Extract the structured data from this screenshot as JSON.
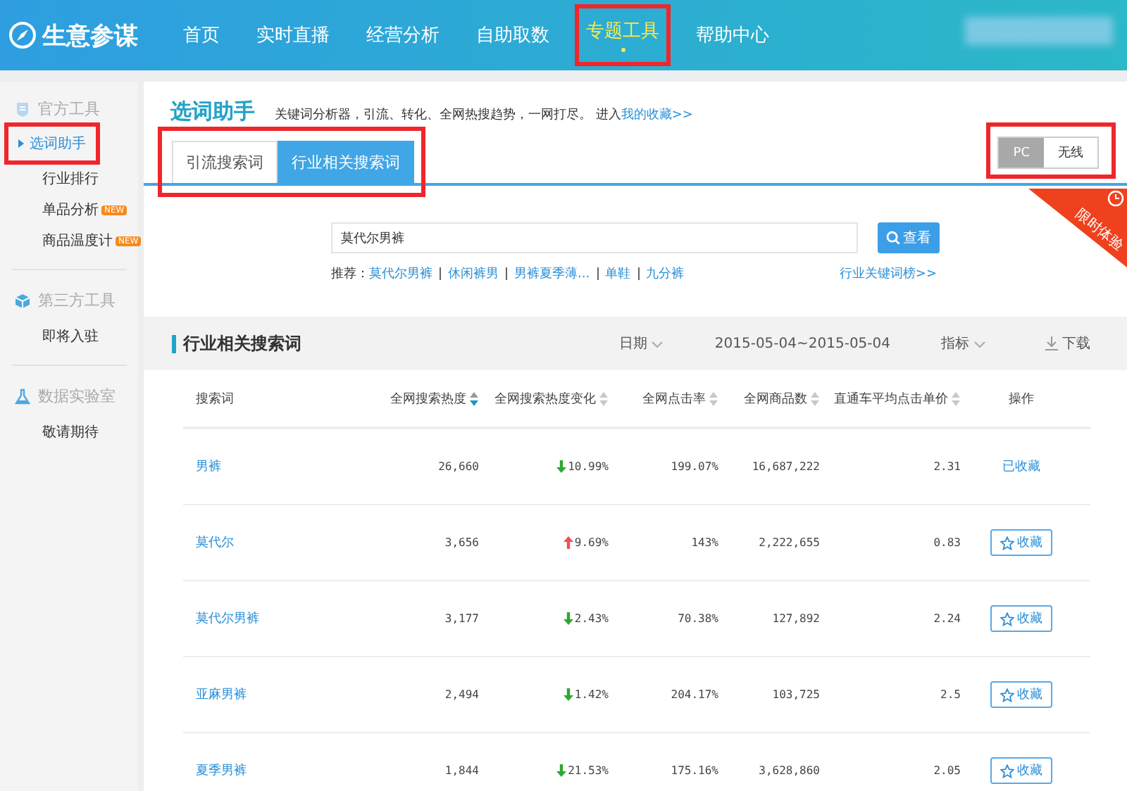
{
  "header": {
    "logo": "生意参谋",
    "nav": [
      {
        "label": "首页",
        "selected": false
      },
      {
        "label": "实时直播",
        "selected": false
      },
      {
        "label": "经营分析",
        "selected": false
      },
      {
        "label": "自助取数",
        "selected": false
      },
      {
        "label": "专题工具",
        "selected": true,
        "highlighted": true
      },
      {
        "label": "帮助中心",
        "selected": false
      }
    ]
  },
  "sidebar": {
    "groups": [
      {
        "kind": "shield",
        "title": "官方工具",
        "items": [
          {
            "label": "选词助手",
            "selected": true,
            "highlighted": true
          },
          {
            "label": "行业排行",
            "selected": false
          },
          {
            "label": "单品分析",
            "badge": "NEW",
            "selected": false
          },
          {
            "label": "商品温度计",
            "badge": "NEW",
            "selected": false
          }
        ]
      },
      {
        "kind": "cube",
        "title": "第三方工具",
        "items": [
          {
            "label": "即将入驻",
            "selected": false
          }
        ]
      },
      {
        "kind": "flask",
        "title": "数据实验室",
        "items": [
          {
            "label": "敬请期待",
            "selected": false
          }
        ]
      }
    ]
  },
  "page": {
    "title": "选词助手",
    "description": "关键词分析器，引流、转化、全网热搜趋势，一网打尽。 进入",
    "favorites_link": "我的收藏>>",
    "tabs": {
      "highlighted": true,
      "items": [
        {
          "label": "引流搜索词",
          "selected": false
        },
        {
          "label": "行业相关搜索词",
          "selected": true
        }
      ]
    },
    "platform": {
      "highlighted": true,
      "options": [
        {
          "label": "PC",
          "selected": true
        },
        {
          "label": "无线",
          "selected": false
        }
      ]
    },
    "ribbon": "限时体验",
    "search": {
      "value": "莫代尔男裤",
      "button": "查看",
      "recommend_label": "推荐：",
      "recommendations": [
        "莫代尔男裤",
        "休闲裤男",
        "男裤夏季薄...",
        "单鞋",
        "九分裤"
      ],
      "ranking_link": "行业关键词榜>>"
    }
  },
  "section": {
    "title": "行业相关搜索词",
    "date_label": "日期",
    "date_range": "2015-05-04~2015-05-04",
    "metrics_label": "指标",
    "download": "下载"
  },
  "table": {
    "columns": [
      {
        "label": "搜索词"
      },
      {
        "label": "全网搜索热度",
        "sorted": true
      },
      {
        "label": "全网搜索热度变化",
        "sorted": false
      },
      {
        "label": "全网点击率",
        "sorted": false
      },
      {
        "label": "全网商品数",
        "sorted": false
      },
      {
        "label": "直通车平均点击单价",
        "sorted": false
      },
      {
        "label": "操作"
      }
    ],
    "rows": [
      {
        "keyword": "男裤",
        "heat": "26,660",
        "change": {
          "kind": "down",
          "value": "10.99%"
        },
        "ctr": "199.07%",
        "products": "16,687,222",
        "avg_price": "2.31",
        "action": {
          "kind": "saved",
          "label": "已收藏"
        }
      },
      {
        "keyword": "莫代尔",
        "heat": "3,656",
        "change": {
          "kind": "up",
          "value": "9.69%"
        },
        "ctr": "143%",
        "products": "2,222,655",
        "avg_price": "0.83",
        "action": {
          "kind": "button",
          "label": "收藏"
        }
      },
      {
        "keyword": "莫代尔男裤",
        "heat": "3,177",
        "change": {
          "kind": "down",
          "value": "2.43%"
        },
        "ctr": "70.38%",
        "products": "127,892",
        "avg_price": "2.24",
        "action": {
          "kind": "button",
          "label": "收藏"
        }
      },
      {
        "keyword": "亚麻男裤",
        "heat": "2,494",
        "change": {
          "kind": "down",
          "value": "1.42%"
        },
        "ctr": "204.17%",
        "products": "103,725",
        "avg_price": "2.5",
        "action": {
          "kind": "button",
          "label": "收藏"
        }
      },
      {
        "keyword": "夏季男裤",
        "heat": "1,844",
        "change": {
          "kind": "down",
          "value": "21.53%"
        },
        "ctr": "175.16%",
        "products": "3,628,860",
        "avg_price": "2.05",
        "action": {
          "kind": "button",
          "label": "收藏"
        }
      }
    ]
  }
}
